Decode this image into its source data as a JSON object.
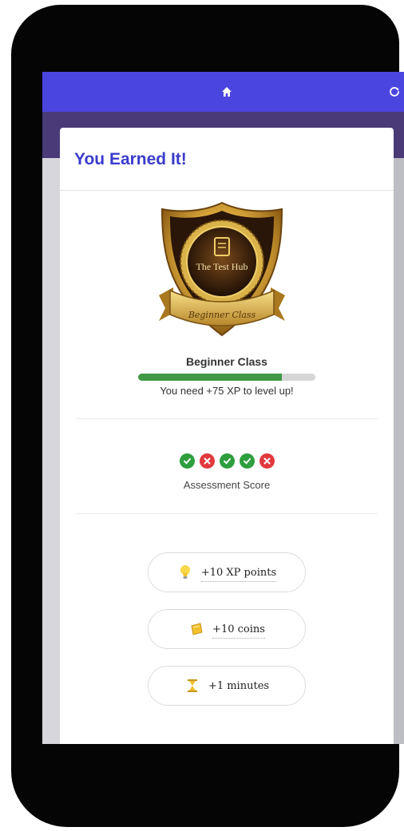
{
  "topbar": {
    "home_icon": "home-icon",
    "refresh_icon": "refresh-icon",
    "color": "#4b45e0"
  },
  "card": {
    "title": "You Earned It!",
    "badge": {
      "emblem_text": "The Test Hub",
      "ribbon_text": "Beginner Class"
    },
    "level": {
      "name": "Beginner Class",
      "progress_percent": 81,
      "message": "You need +75 XP to level up!"
    },
    "assessment": {
      "results": [
        "correct",
        "wrong",
        "correct",
        "correct",
        "wrong"
      ],
      "label": "Assessment Score"
    },
    "rewards": [
      {
        "icon": "lightbulb-icon",
        "label": "+10 XP points"
      },
      {
        "icon": "coins-icon",
        "label": "+10 coins"
      },
      {
        "icon": "hourglass-icon",
        "label": "+1 minutes"
      }
    ]
  },
  "colors": {
    "accent": "#3b3ccc",
    "progress": "#3f9a43",
    "correct": "#2e9e3e",
    "wrong": "#e0383e"
  }
}
